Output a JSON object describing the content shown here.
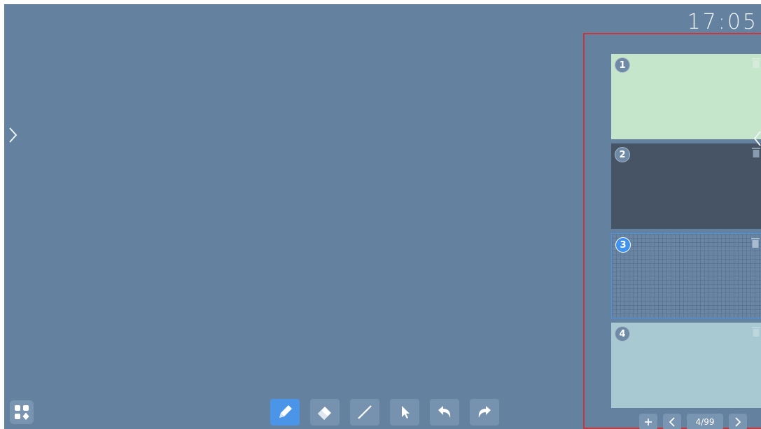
{
  "clock": {
    "time": "17:05"
  },
  "colors": {
    "background": "#6482a0",
    "accent": "#4a95e8",
    "panel_border": "#c8383a",
    "page1": "#c6e6cc",
    "page2": "#465466",
    "page4": "#a8c8d2"
  },
  "toolbar": {
    "tools": [
      {
        "name": "pen",
        "icon": "pencil-icon",
        "active": true
      },
      {
        "name": "eraser",
        "icon": "eraser-icon",
        "active": false
      },
      {
        "name": "line",
        "icon": "line-icon",
        "active": false
      },
      {
        "name": "select",
        "icon": "pointer-icon",
        "active": false
      },
      {
        "name": "undo",
        "icon": "undo-icon",
        "active": false
      },
      {
        "name": "redo",
        "icon": "redo-icon",
        "active": false
      }
    ]
  },
  "pages_panel": {
    "pages": [
      {
        "number": "1",
        "background": "light-green",
        "selected": false
      },
      {
        "number": "2",
        "background": "dark-slate",
        "selected": false
      },
      {
        "number": "3",
        "background": "grid",
        "selected": true
      },
      {
        "number": "4",
        "background": "light-blue",
        "selected": false
      }
    ],
    "pager": {
      "add_icon": "plus-icon",
      "prev_icon": "chevron-left-icon",
      "count": "4/99",
      "next_icon": "chevron-right-icon"
    }
  }
}
